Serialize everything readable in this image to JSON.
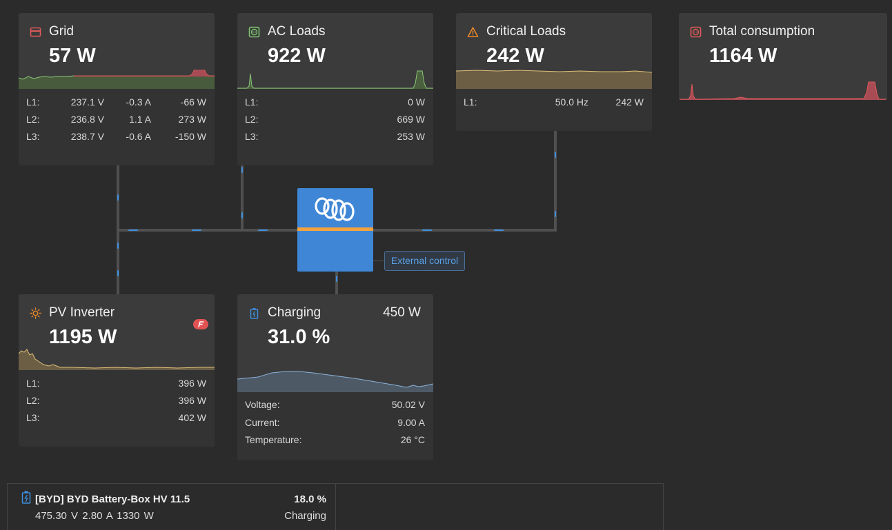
{
  "grid": {
    "title": "Grid",
    "value": "57 W",
    "rows": [
      {
        "label": "L1:",
        "voltage": "237.1 V",
        "current": "-0.3 A",
        "power": "-66 W"
      },
      {
        "label": "L2:",
        "voltage": "236.8 V",
        "current": "1.1 A",
        "power": "273 W"
      },
      {
        "label": "L3:",
        "voltage": "238.7 V",
        "current": "-0.6 A",
        "power": "-150 W"
      }
    ]
  },
  "ac_loads": {
    "title": "AC Loads",
    "value": "922 W",
    "rows": [
      {
        "label": "L1:",
        "power": "0 W"
      },
      {
        "label": "L2:",
        "power": "669 W"
      },
      {
        "label": "L3:",
        "power": "253 W"
      }
    ]
  },
  "critical_loads": {
    "title": "Critical Loads",
    "value": "242 W",
    "rows": [
      {
        "label": "L1:",
        "frequency": "50.0 Hz",
        "power": "242 W"
      }
    ]
  },
  "total_consumption": {
    "title": "Total consumption",
    "value": "1164 W"
  },
  "pv_inverter": {
    "title": "PV Inverter",
    "value": "1195 W",
    "rows": [
      {
        "label": "L1:",
        "power": "396 W"
      },
      {
        "label": "L2:",
        "power": "396 W"
      },
      {
        "label": "L3:",
        "power": "402 W"
      }
    ]
  },
  "charging": {
    "title": "Charging",
    "power": "450 W",
    "value": "31.0 %",
    "rows": [
      {
        "label": "Voltage:",
        "value": "50.02 V"
      },
      {
        "label": "Current:",
        "value": "9.00 A"
      },
      {
        "label": "Temperature:",
        "value": "26 °C"
      }
    ]
  },
  "external_control": "External control",
  "battery": {
    "name": "[BYD] BYD Battery-Box HV 11.5",
    "stats": "475.30 V   2.80 A   1330 W",
    "soc": "18.0 %",
    "state": "Charging"
  },
  "colors": {
    "background": "#2b2b2b",
    "card": "#3b3b3b",
    "flow": "#3d8fe0",
    "inverter": "#3f87d6",
    "inverter_stripe": "#f3a33d",
    "grid_icon": "#e05a5a",
    "ac_icon": "#7cc46e",
    "critical_icon": "#f08a2a",
    "consumption_icon": "#e05a5a",
    "pv_icon": "#f08a2a",
    "battery_icon": "#3d8fe0"
  },
  "icons": {
    "grid": "grid-meter-icon",
    "ac_loads": "socket-icon",
    "critical_loads": "warning-icon",
    "total_consumption": "socket-icon",
    "pv_inverter": "sun-icon",
    "charging": "battery-charging-icon",
    "inverter": "victron-logo-icon",
    "pv_badge": "fronius-badge-icon"
  }
}
